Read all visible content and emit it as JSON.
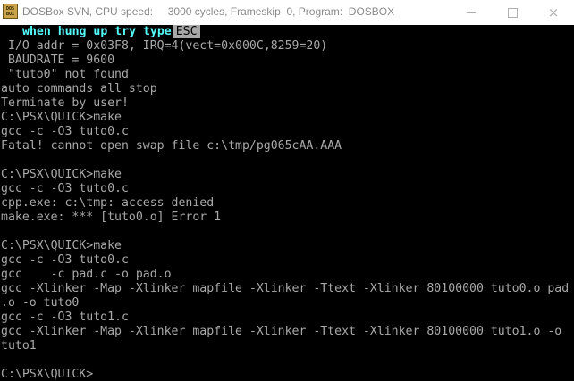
{
  "window": {
    "title": "DOSBox SVN, CPU speed:     3000 cycles, Frameskip  0, Program:  DOSBOX",
    "icon_lines": [
      "DOS",
      "BOX"
    ],
    "controls": {
      "minimize": "minimize-icon",
      "maximize": "maximize-icon",
      "close": "×"
    }
  },
  "console": {
    "hint_text": "when hung up try type",
    "hint_key": "ESC",
    "lines": [
      " I/O addr = 0x03F8, IRQ=4(vect=0x000C,8259=20)",
      " BAUDRATE = 9600",
      " \"tuto0\" not found",
      "auto commands all stop",
      "Terminate by user!",
      "C:\\PSX\\QUICK>make",
      "gcc -c -O3 tuto0.c",
      "Fatal! cannot open swap file c:\\tmp/pg065cAA.AAA",
      "",
      "C:\\PSX\\QUICK>make",
      "gcc -c -O3 tuto0.c",
      "cpp.exe: c:\\tmp: access denied",
      "make.exe: *** [tuto0.o] Error 1",
      "",
      "C:\\PSX\\QUICK>make",
      "gcc -c -O3 tuto0.c",
      "gcc    -c pad.c -o pad.o",
      "gcc -Xlinker -Map -Xlinker mapfile -Xlinker -Ttext -Xlinker 80100000 tuto0.o pad",
      ".o -o tuto0",
      "gcc -c -O3 tuto1.c",
      "gcc -Xlinker -Map -Xlinker mapfile -Xlinker -Ttext -Xlinker 80100000 tuto1.o -o",
      "tuto1",
      "",
      "C:\\PSX\\QUICK>"
    ]
  },
  "colors": {
    "console_bg": "#000000",
    "console_text": "#a8a8a8",
    "hint_text": "#54fcfc",
    "titlebar_bg": "#ffffff",
    "title_text": "#8a8a8a"
  }
}
